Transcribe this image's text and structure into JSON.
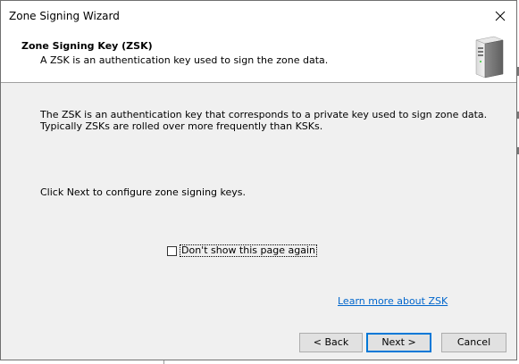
{
  "window": {
    "title": "Zone Signing Wizard"
  },
  "header": {
    "title": "Zone Signing Key (ZSK)",
    "subtitle": "A ZSK is an authentication key used to sign the zone data."
  },
  "body": {
    "description_lines": [
      "The ZSK is an authentication key that corresponds to a private key used to sign zone data.",
      "Typically ZSKs are rolled over more frequently than KSKs."
    ],
    "instruction": "Click Next to configure zone signing keys.",
    "checkbox_label": "Don't show this page again",
    "checkbox_checked": false,
    "learn_more_link": "Learn more about ZSK"
  },
  "buttons": {
    "back": "< Back",
    "next": "Next >",
    "cancel": "Cancel"
  },
  "colors": {
    "link": "#0066cc",
    "focus": "#0078d7"
  }
}
